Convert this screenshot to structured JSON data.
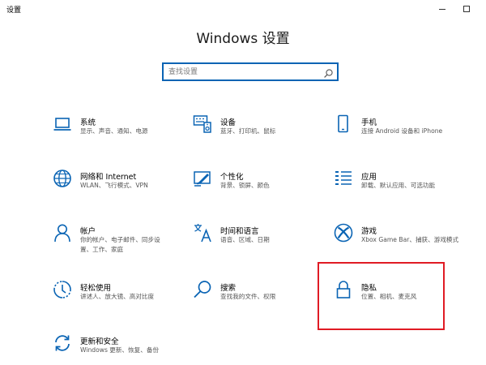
{
  "window": {
    "title": "设置"
  },
  "heading": "Windows 设置",
  "search": {
    "placeholder": "查找设置",
    "value": ""
  },
  "colors": {
    "accent": "#0a64b4",
    "highlight": "#e01b24"
  },
  "tiles": [
    {
      "id": "system",
      "icon": "laptop-icon",
      "name": "系统",
      "desc": "显示、声音、通知、电源"
    },
    {
      "id": "devices",
      "icon": "keyboard-speaker-icon",
      "name": "设备",
      "desc": "蓝牙、打印机、鼠标"
    },
    {
      "id": "phone",
      "icon": "phone-icon",
      "name": "手机",
      "desc": "连接 Android 设备和 iPhone"
    },
    {
      "id": "network",
      "icon": "globe-icon",
      "name": "网络和 Internet",
      "desc": "WLAN、飞行模式、VPN"
    },
    {
      "id": "personalization",
      "icon": "paint-screen-icon",
      "name": "个性化",
      "desc": "背景、锁屏、颜色"
    },
    {
      "id": "apps",
      "icon": "app-list-icon",
      "name": "应用",
      "desc": "卸载、默认应用、可选功能"
    },
    {
      "id": "accounts",
      "icon": "person-icon",
      "name": "帐户",
      "desc": "你的帐户、电子邮件、同步设置、工作、家庭"
    },
    {
      "id": "time-language",
      "icon": "language-icon",
      "name": "时间和语言",
      "desc": "语音、区域、日期"
    },
    {
      "id": "gaming",
      "icon": "xbox-icon",
      "name": "游戏",
      "desc": "Xbox Game Bar、捕获、游戏模式"
    },
    {
      "id": "ease-of-access",
      "icon": "ease-of-access-icon",
      "name": "轻松使用",
      "desc": "讲述人、放大镜、高对比度"
    },
    {
      "id": "search",
      "icon": "magnifier-icon",
      "name": "搜索",
      "desc": "查找我的文件、权限"
    },
    {
      "id": "privacy",
      "icon": "lock-icon",
      "name": "隐私",
      "desc": "位置、相机、麦克风"
    },
    {
      "id": "update-security",
      "icon": "sync-icon",
      "name": "更新和安全",
      "desc": "Windows 更新、恢复、备份"
    }
  ]
}
